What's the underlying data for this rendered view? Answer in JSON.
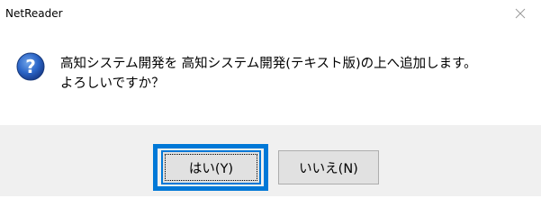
{
  "window": {
    "title": "NetReader",
    "close_icon": "close-icon"
  },
  "message": {
    "icon": "question-icon",
    "line1": "高知システム開発を 高知システム開発(テキスト版)の上へ追加します。",
    "line2": "よろしいですか？"
  },
  "buttons": {
    "yes_label": "はい(Y)",
    "no_label": "いいえ(N)"
  },
  "colors": {
    "focus_accent": "#0078d7",
    "button_area_bg": "#f0f0f0",
    "button_face": "#e1e1e1"
  }
}
